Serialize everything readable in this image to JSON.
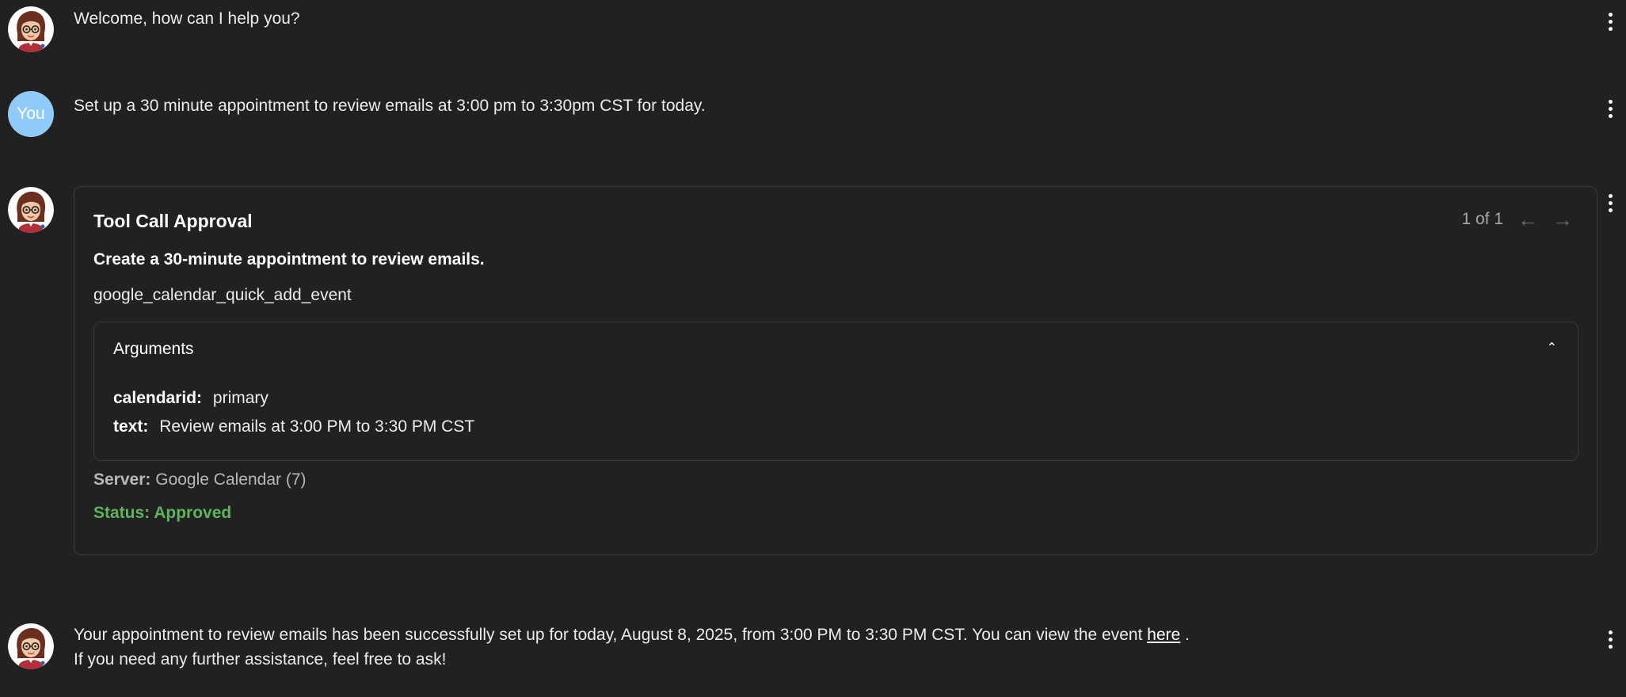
{
  "messages": {
    "welcome": {
      "text": "Welcome, how can I help you?"
    },
    "user": {
      "avatar_label": "You",
      "text": "Set up a 30 minute appointment to review emails at 3:00 pm to 3:30pm CST for today."
    },
    "tool_call": {
      "title": "Tool Call Approval",
      "pager": "1 of 1",
      "description": "Create a 30-minute appointment to review emails.",
      "function_name": "google_calendar_quick_add_event",
      "arguments_title": "Arguments",
      "arguments": [
        {
          "key": "calendarid:",
          "value": "primary"
        },
        {
          "key": "text:",
          "value": "Review emails at 3:00 PM to 3:30 PM CST"
        }
      ],
      "server_label": "Server:",
      "server_value": "Google Calendar (7)",
      "status": "Status: Approved"
    },
    "reply": {
      "line1_before": "Your appointment to review emails has been successfully set up for today, August 8, 2025, from 3:00 PM to 3:30 PM CST. You can view the event ",
      "link_text": "here",
      "line1_after": " .",
      "line2": "If you need any further assistance, feel free to ask!"
    }
  },
  "icons": {
    "kebab": "more-vertical-icon",
    "prev": "arrow-left-icon",
    "next": "arrow-right-icon",
    "collapse": "chevron-up-icon"
  },
  "colors": {
    "background": "#212121",
    "user_avatar": "#90caf9",
    "status_approved": "#5fb35f"
  }
}
